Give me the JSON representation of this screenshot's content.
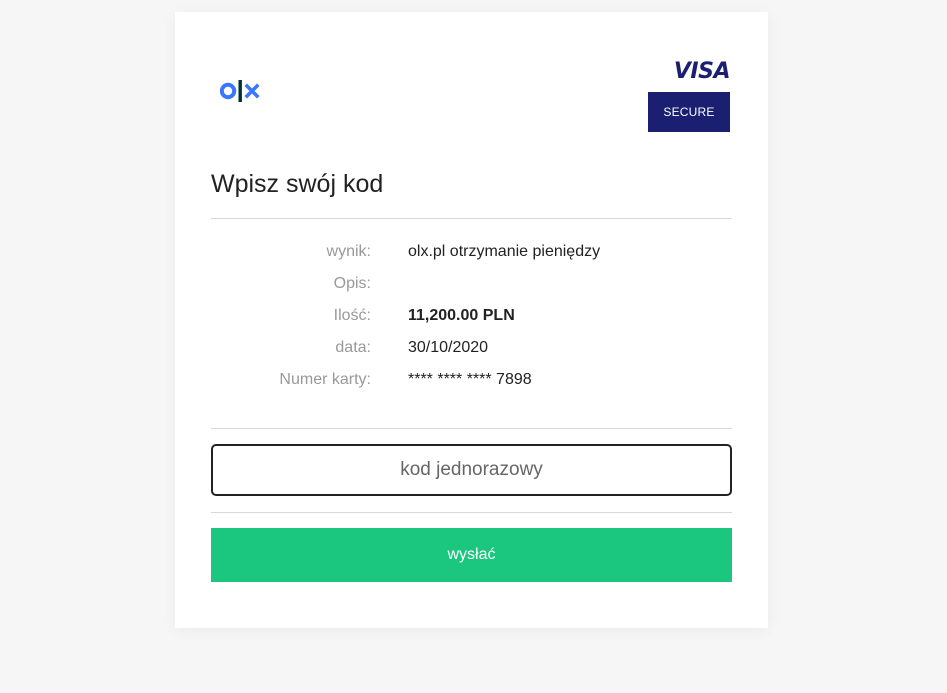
{
  "brand": {
    "merchant_logo": "olx-logo",
    "visa_text": "VISA",
    "secure_text": "SECURE",
    "colors": {
      "olx_blue": "#002f34",
      "olx_accent": "#3a77ff",
      "visa_navy": "#1a1f71",
      "button_green": "#1bc67e"
    }
  },
  "form": {
    "title": "Wpisz swój kod",
    "details": [
      {
        "label": "wynik:",
        "value": "olx.pl otrzymanie pieniędzy"
      },
      {
        "label": "Opis:",
        "value": ""
      },
      {
        "label": "Ilość:",
        "value": "11,200.00 PLN"
      },
      {
        "label": "data:",
        "value": "30/10/2020"
      },
      {
        "label": "Numer karty:",
        "value": "**** **** **** 7898"
      }
    ],
    "otp_placeholder": "kod jednorazowy",
    "submit_label": "wysłać"
  }
}
